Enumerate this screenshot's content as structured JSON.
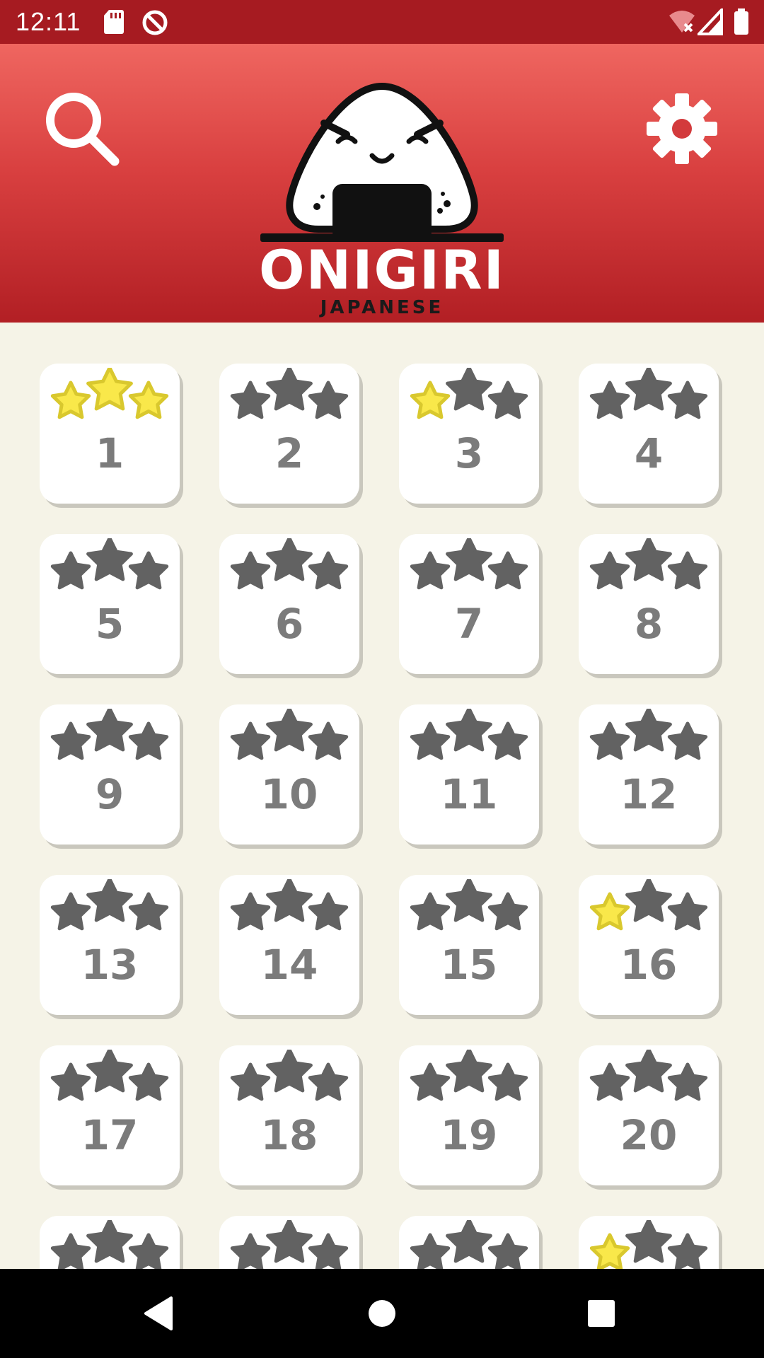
{
  "status_bar": {
    "time": "12:11",
    "icons": [
      "sd-card-icon",
      "data-saver-icon",
      "wifi-off-icon",
      "cell-signal-icon",
      "battery-icon"
    ]
  },
  "header": {
    "logo_title": "ONIGIRI",
    "logo_subtitle": "JAPANESE",
    "search_icon": "search-icon",
    "settings_icon": "gear-icon"
  },
  "colors": {
    "status_bar": "#a61b21",
    "header_top": "#ef6660",
    "header_bottom": "#b21f24",
    "background": "#f5f3e7",
    "star_earned": "#f9e84a",
    "star_empty": "#626262",
    "level_number": "#7b7b7b"
  },
  "levels": [
    {
      "number": "1",
      "stars": 3
    },
    {
      "number": "2",
      "stars": 0
    },
    {
      "number": "3",
      "stars": 1
    },
    {
      "number": "4",
      "stars": 0
    },
    {
      "number": "5",
      "stars": 0
    },
    {
      "number": "6",
      "stars": 0
    },
    {
      "number": "7",
      "stars": 0
    },
    {
      "number": "8",
      "stars": 0
    },
    {
      "number": "9",
      "stars": 0
    },
    {
      "number": "10",
      "stars": 0
    },
    {
      "number": "11",
      "stars": 0
    },
    {
      "number": "12",
      "stars": 0
    },
    {
      "number": "13",
      "stars": 0
    },
    {
      "number": "14",
      "stars": 0
    },
    {
      "number": "15",
      "stars": 0
    },
    {
      "number": "16",
      "stars": 1
    },
    {
      "number": "17",
      "stars": 0
    },
    {
      "number": "18",
      "stars": 0
    },
    {
      "number": "19",
      "stars": 0
    },
    {
      "number": "20",
      "stars": 0
    },
    {
      "number": "",
      "stars": 0
    },
    {
      "number": "",
      "stars": 0
    },
    {
      "number": "",
      "stars": 0
    },
    {
      "number": "",
      "stars": 1
    }
  ],
  "nav_bar": {
    "back_icon": "back-icon",
    "home_icon": "home-icon",
    "recents_icon": "recents-icon"
  }
}
